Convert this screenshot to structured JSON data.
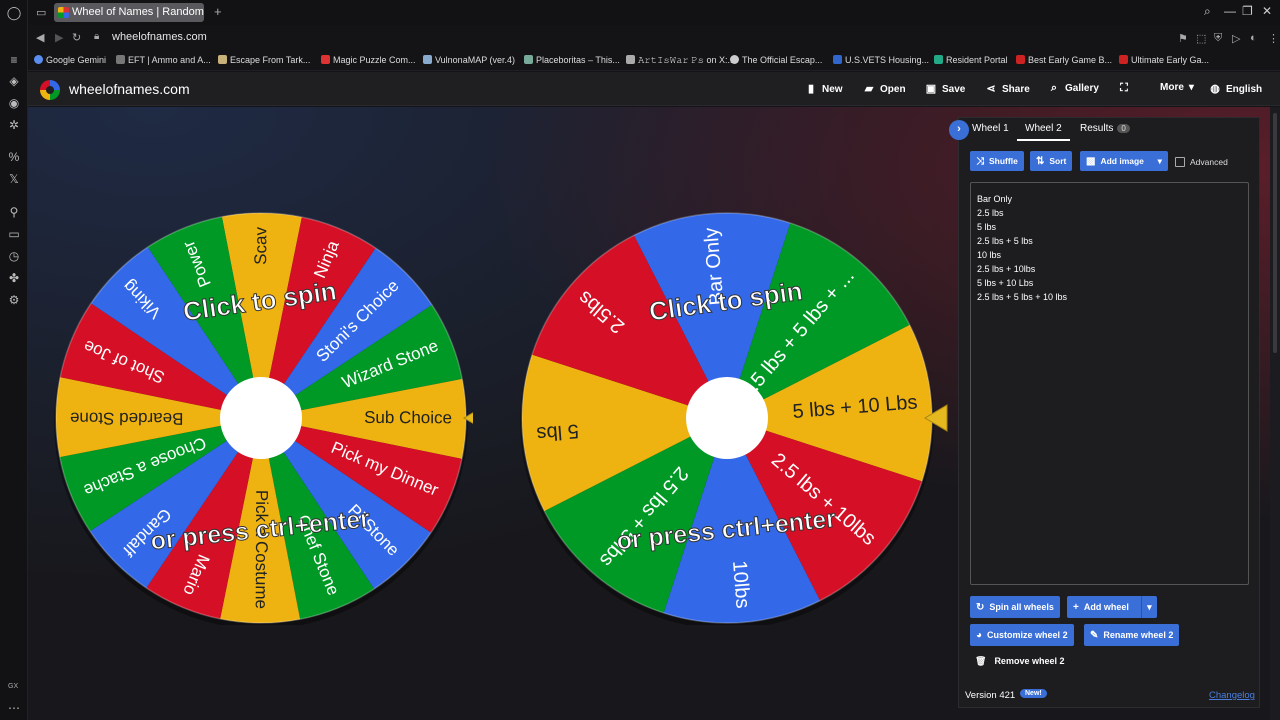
{
  "browser": {
    "tab_title": "Wheel of Names | Random",
    "url": "wheelofnames.com",
    "bookmarks": [
      {
        "label": "Google Gemini",
        "color": "#5b8def"
      },
      {
        "label": "EFT | Ammo and A...",
        "color": "#888"
      },
      {
        "label": "Escape From Tark...",
        "color": "#c9b27a"
      },
      {
        "label": "Magic Puzzle Com...",
        "color": "#d33"
      },
      {
        "label": "VulnonaMAP (ver.4)",
        "color": "#8ac"
      },
      {
        "label": "Placeboritas – This...",
        "color": "#7a9"
      },
      {
        "label": "𝙰𝚛𝚝𝙸𝚜𝚆𝚊𝚛 𝙿𝚜 on X:...",
        "color": "#aaa"
      },
      {
        "label": "The Official Escap...",
        "color": "#ccc"
      },
      {
        "label": "U.S.VETS Housing...",
        "color": "#36c"
      },
      {
        "label": "Resident Portal",
        "color": "#2a8"
      },
      {
        "label": "Best Early Game B...",
        "color": "#c22"
      },
      {
        "label": "Ultimate Early Ga...",
        "color": "#c22"
      }
    ],
    "gx_label": "GX"
  },
  "site": {
    "name": "wheelofnames.com",
    "nav": {
      "new": "New",
      "open": "Open",
      "save": "Save",
      "share": "Share",
      "gallery": "Gallery",
      "more": "More",
      "language": "English"
    }
  },
  "wheel1": {
    "segments": [
      {
        "label": "Scav",
        "color": "#eeb211"
      },
      {
        "label": "Ninja",
        "color": "#d50f25"
      },
      {
        "label": "Stoni's Choice",
        "color": "#3369e8"
      },
      {
        "label": "Wizard Stone",
        "color": "#009925"
      },
      {
        "label": "Sub Choice",
        "color": "#eeb211"
      },
      {
        "label": "Pick my Dinner",
        "color": "#d50f25"
      },
      {
        "label": "Pi Stone",
        "color": "#3369e8"
      },
      {
        "label": "Chef Stone",
        "color": "#009925"
      },
      {
        "label": "Pick a Costume",
        "color": "#eeb211"
      },
      {
        "label": "Mario",
        "color": "#d50f25"
      },
      {
        "label": "Gandalf",
        "color": "#3369e8"
      },
      {
        "label": "Choose a Stache",
        "color": "#009925"
      },
      {
        "label": "Bearded Stone",
        "color": "#eeb211"
      },
      {
        "label": "Shot of Joe",
        "color": "#d50f25"
      },
      {
        "label": "Viking",
        "color": "#3369e8"
      },
      {
        "label": "Power",
        "color": "#009925"
      }
    ],
    "click_text": "Click to spin",
    "press_text": "or press ctrl+enter"
  },
  "wheel2": {
    "segments": [
      {
        "label": "Bar Only",
        "color": "#3369e8"
      },
      {
        "label": "2.5 lbs + 5 lbs + ...",
        "color": "#009925"
      },
      {
        "label": "5 lbs + 10 Lbs",
        "color": "#eeb211"
      },
      {
        "label": "2.5 lbs + 10lbs",
        "color": "#d50f25"
      },
      {
        "label": "10lbs",
        "color": "#3369e8"
      },
      {
        "label": "2.5 lbs + 5 lbs",
        "color": "#009925"
      },
      {
        "label": "5 lbs",
        "color": "#eeb211"
      },
      {
        "label": "2.5lbs",
        "color": "#d50f25"
      }
    ],
    "click_text": "Click to spin",
    "press_text": "or press ctrl+enter"
  },
  "panel": {
    "tabs": {
      "wheel1": "Wheel 1",
      "wheel2": "Wheel 2",
      "results": "Results",
      "results_count": "0"
    },
    "shuffle": "Shuffle",
    "sort": "Sort",
    "add_image": "Add image",
    "advanced": "Advanced",
    "entries": [
      "Bar Only",
      "2.5 lbs",
      "5 lbs",
      "2.5 lbs + 5 lbs",
      "10 lbs",
      "2.5 lbs + 10lbs",
      "5 lbs + 10 Lbs",
      "2.5 lbs + 5 lbs + 10 lbs"
    ],
    "spin_all": "Spin all wheels",
    "add_wheel": "Add wheel",
    "customize": "Customize wheel 2",
    "rename": "Rename wheel 2",
    "remove": "Remove wheel 2",
    "version": "Version 421",
    "new_badge": "New!",
    "changelog": "Changelog"
  }
}
